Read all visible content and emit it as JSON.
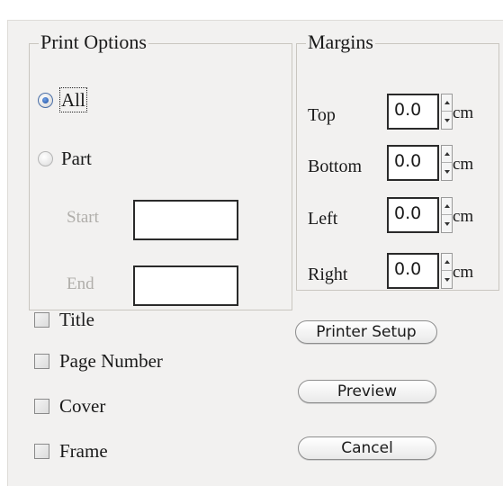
{
  "print_options": {
    "legend": "Print Options",
    "radio_all": {
      "label": "All",
      "checked": true
    },
    "radio_part": {
      "label": "Part",
      "checked": false
    },
    "start_label": "Start",
    "start_value": "",
    "end_label": "End",
    "end_value": ""
  },
  "margins": {
    "legend": "Margins",
    "unit": "cm",
    "top": {
      "label": "Top",
      "value": "0.0"
    },
    "bottom": {
      "label": "Bottom",
      "value": "0.0"
    },
    "left": {
      "label": "Left",
      "value": "0.0"
    },
    "right": {
      "label": "Right",
      "value": "0.0"
    }
  },
  "options": {
    "title": {
      "label": "Title",
      "checked": false
    },
    "page_number": {
      "label": "Page Number",
      "checked": false
    },
    "cover": {
      "label": "Cover",
      "checked": false
    },
    "frame": {
      "label": "Frame",
      "checked": false
    }
  },
  "buttons": {
    "printer_setup": "Printer Setup",
    "preview": "Preview",
    "cancel": "Cancel"
  }
}
